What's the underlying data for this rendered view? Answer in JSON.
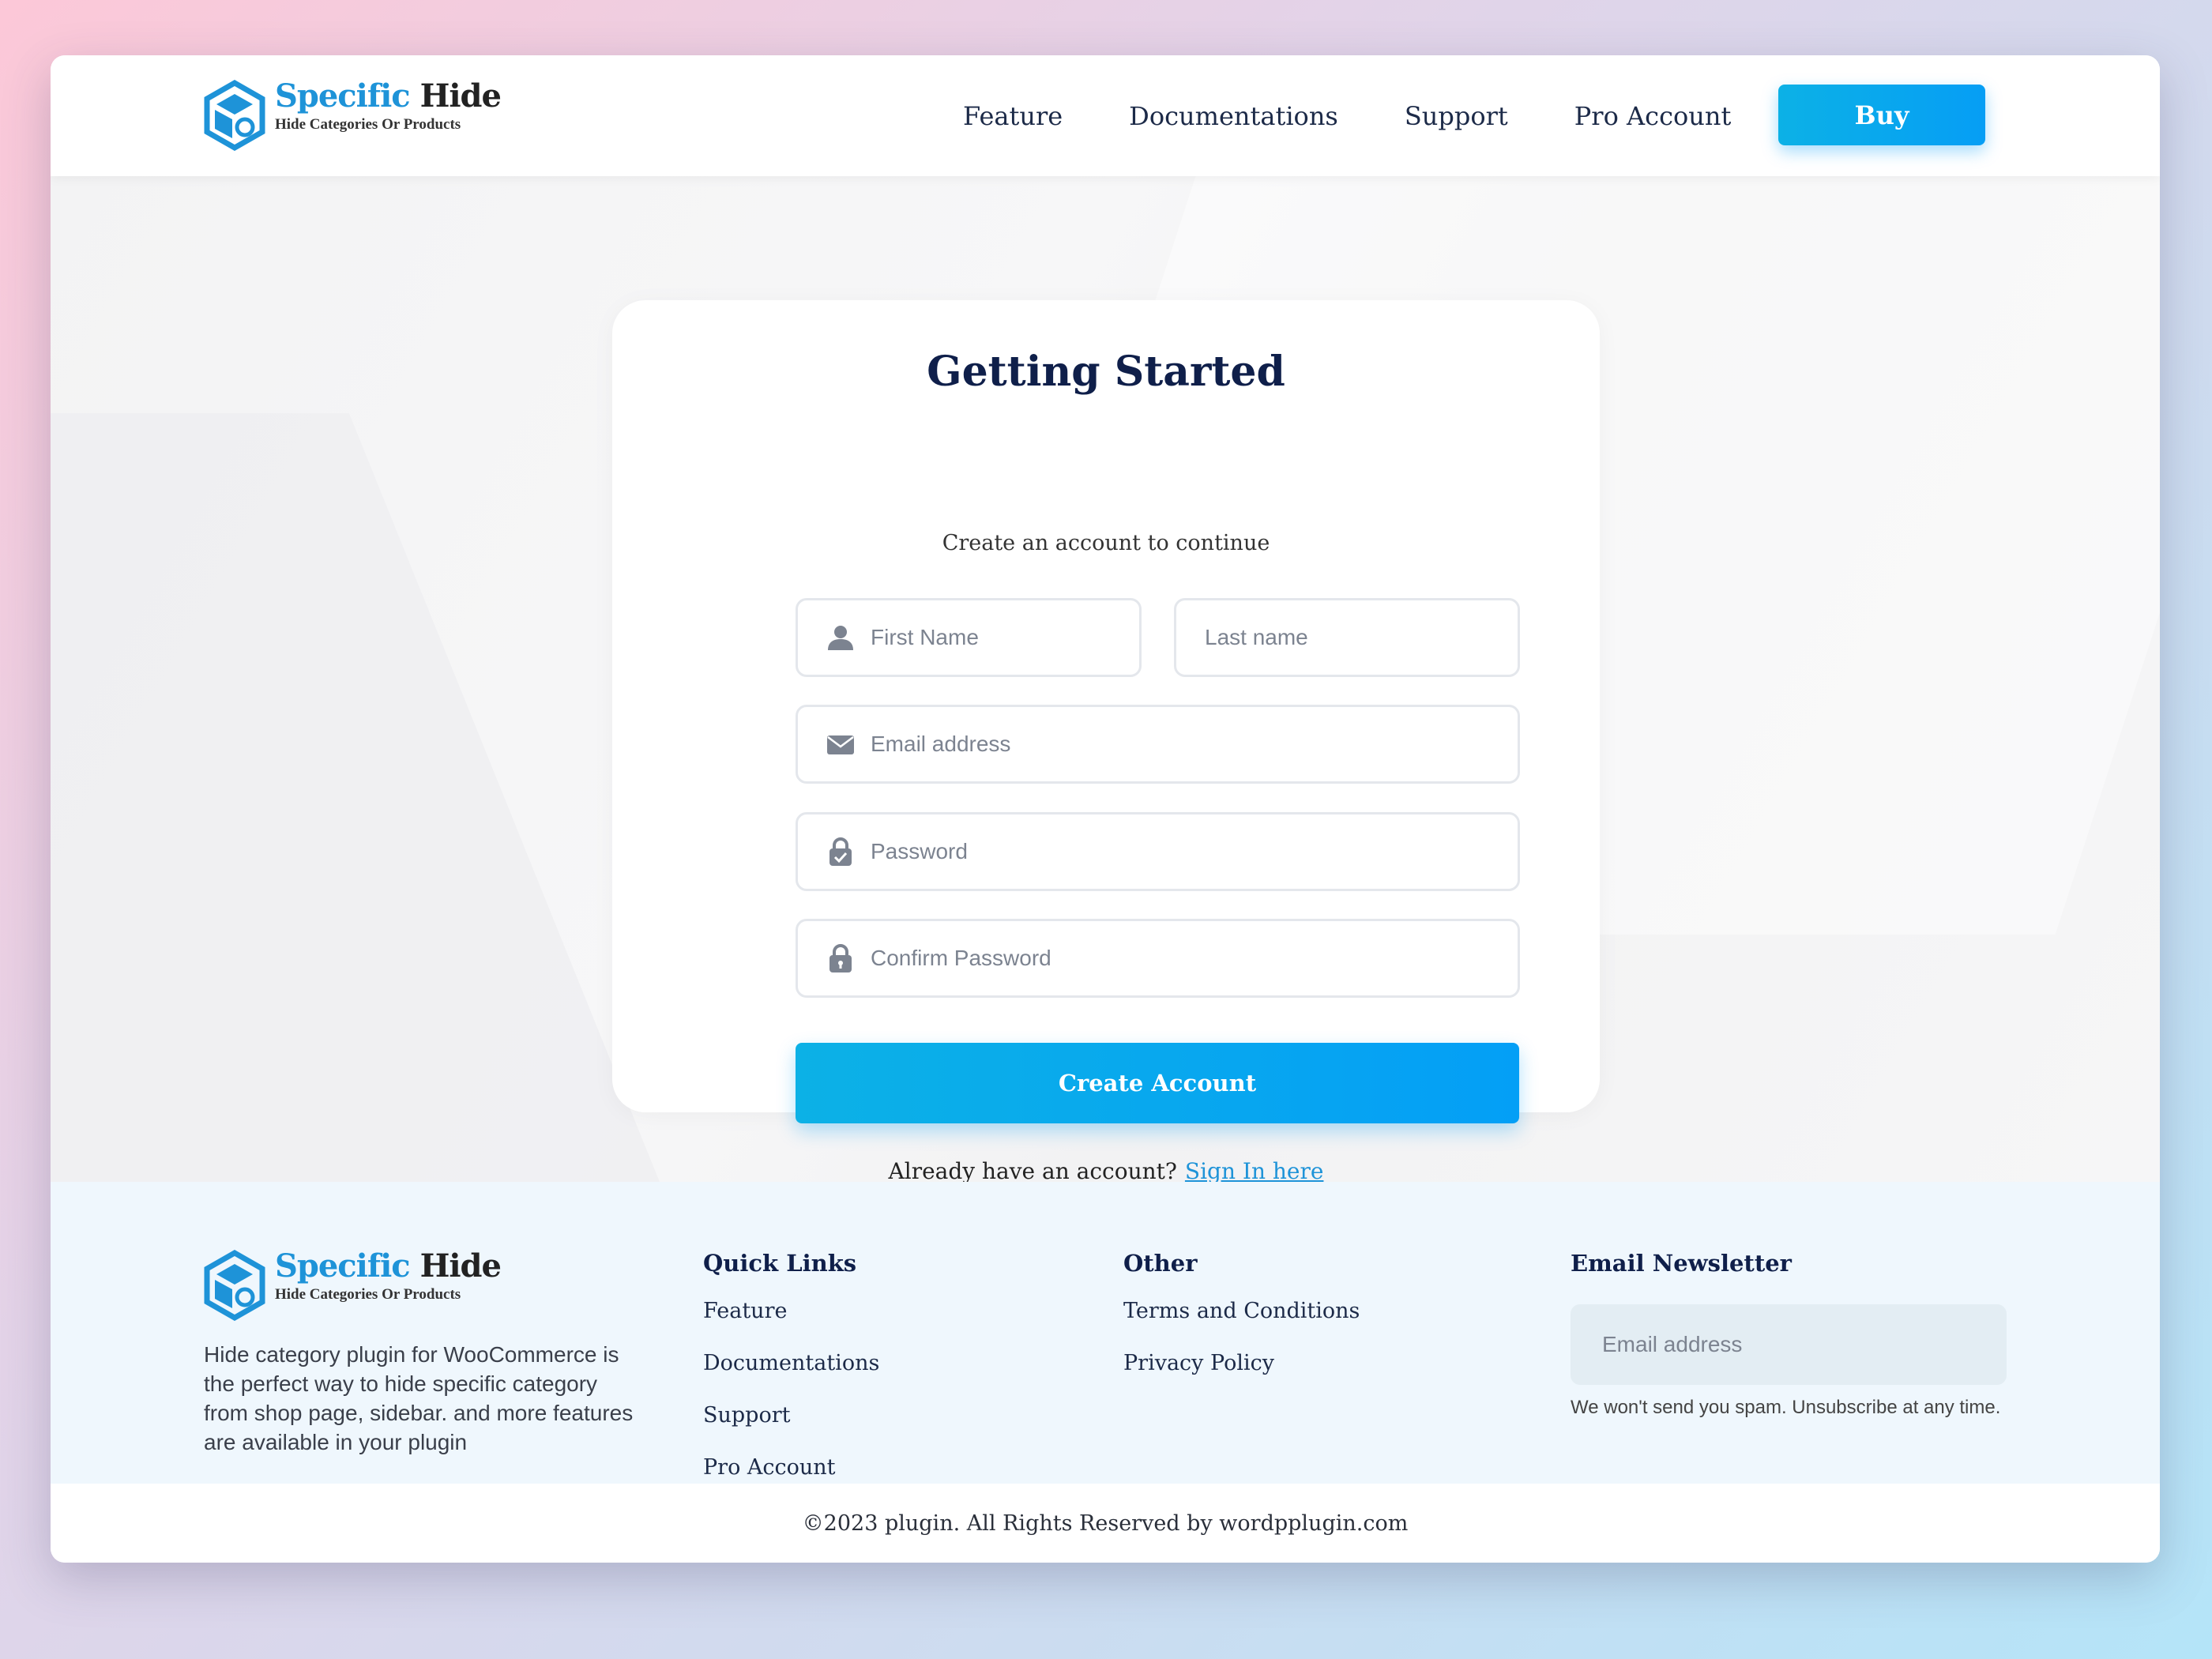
{
  "header": {
    "logo": {
      "name_accent": "Specific",
      "name_rest": "Hide",
      "tagline": "Hide Categories Or Products"
    },
    "nav": [
      {
        "label": "Feature"
      },
      {
        "label": "Documentations"
      },
      {
        "label": "Support"
      },
      {
        "label": "Pro Account"
      }
    ],
    "buy_label": "Buy"
  },
  "signup": {
    "title": "Getting Started",
    "subtitle": "Create an account to continue",
    "first_name_placeholder": "First Name",
    "last_name_placeholder": "Last name",
    "email_placeholder": "Email address",
    "password_placeholder": "Password",
    "confirm_password_placeholder": "Confirm Password",
    "submit_label": "Create Account",
    "signin_prompt": "Already have an account?",
    "signin_link": "Sign In here"
  },
  "footer": {
    "logo": {
      "name_accent": "Specific",
      "name_rest": "Hide",
      "tagline": "Hide Categories Or Products"
    },
    "description": "Hide category plugin for WooCommerce is the perfect way to hide specific category from shop page, sidebar. and more features are available in your plugin",
    "quick_links": {
      "heading": "Quick Links",
      "items": [
        "Feature",
        "Documentations",
        "Support",
        "Pro Account"
      ]
    },
    "other": {
      "heading": "Other",
      "items": [
        "Terms and Conditions",
        "Privacy Policy"
      ]
    },
    "newsletter": {
      "heading": "Email Newsletter",
      "placeholder": "Email address",
      "note": "We won't send you spam. Unsubscribe at any time."
    },
    "copyright": "©2023 plugin. All Rights Reserved by wordpplugin.com"
  },
  "colors": {
    "accent": "#1e93d8",
    "button_gradient_start": "#0cb1e6",
    "button_gradient_end": "#069ef5",
    "heading": "#0f1f4a"
  },
  "icons": [
    "logo-cube-icon",
    "user-icon",
    "envelope-icon",
    "lock-check-icon",
    "lock-icon"
  ]
}
